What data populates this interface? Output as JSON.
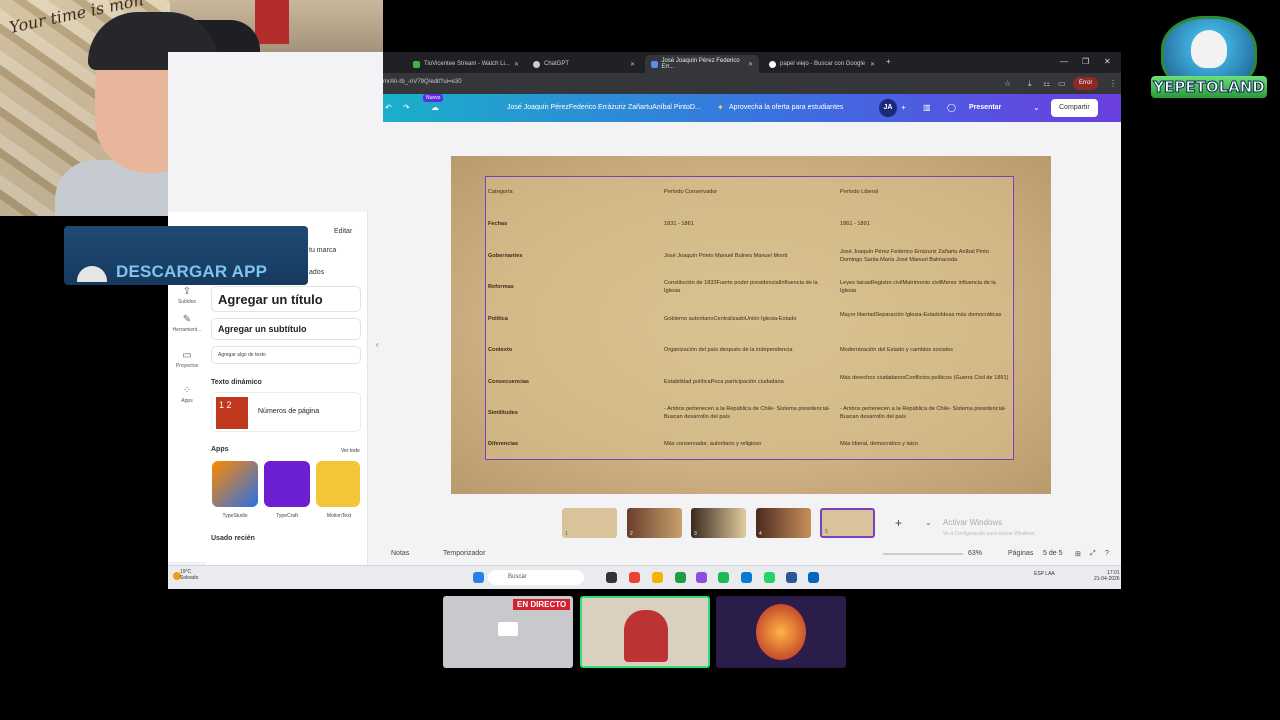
{
  "webcam": {
    "wall_text": "Your time is mon"
  },
  "download_banner": {
    "label": "DESCARGAR APP"
  },
  "logo": {
    "name": "YEPETOLAND"
  },
  "browser": {
    "tabs": [
      {
        "label": "TioVicentee Stream - Watch Li..."
      },
      {
        "label": "ChatGPT"
      },
      {
        "label": "José Joaquín Pérez Federico Err...",
        "active": true
      },
      {
        "label": "papel viejo - Buscar con Google"
      }
    ],
    "url": "mrAh-rb_-nV79Q/edit?ui=e30",
    "error_label": "Error"
  },
  "canva": {
    "new_badge": "Nuevo",
    "doc_title": "José Joaquín PérezFederico Errázuriz ZañartuAníbal PintoD...",
    "promo": "Aprovecha la oferta para estudiantes",
    "avatar": "JA",
    "present": "Presentar",
    "share": "Compartir"
  },
  "rail": [
    "Subidos",
    "Herramient...",
    "Proyectos",
    "Apps"
  ],
  "panel": {
    "edit": "Editar",
    "brand": "tu marca",
    "brand_sub": "ados",
    "title_card": "Agregar un título",
    "subtitle_card": "Agregar un subtítulo",
    "text_card": "Agregar algo de texto",
    "dynamic_text": "Texto dinámico",
    "page_numbers": "Números de página",
    "apps_heading": "Apps",
    "see_all": "Ver todo",
    "apps": [
      "TypeStudio",
      "TypeCraft",
      "MotionText"
    ],
    "recent": "Usado recién"
  },
  "slide": {
    "headers": [
      "Categoría",
      "Período Conservador",
      "Período Liberal"
    ],
    "rows": [
      [
        "Fechas",
        "1831 - 1861",
        "1861 - 1891"
      ],
      [
        "Gobernantes",
        "José Joaquín Prieto Manuel Bulnes Manuel Montt",
        "José Joaquín Pérez Federico Errázuriz Zañartu Aníbal Pinto Domingo Santa María José Manuel Balmaceda"
      ],
      [
        "Reformas",
        "Constitución de 1833Fuerte poder presidencialInfluencia de la Iglesia",
        "Leyes laicasRegistro civilMatrimonio civilMenor influencia de la Iglesia"
      ],
      [
        "Política",
        "Gobierno autoritarioCentralizadoUnión Iglesia-Estado",
        "Mayor libertadSeparación Iglesia-EstadoIdeas más democráticas"
      ],
      [
        "Contexto",
        "Organización del país después de la independencia",
        "Modernización del Estado y cambios sociales"
      ],
      [
        "Consecuencias",
        "Estabilidad políticaPoca participación ciudadana",
        "Más derechos ciudadanosConflictos políticos (Guerra Civil de 1891)"
      ],
      [
        "Similitudes",
        "- Ambos pertenecen a la República de Chile- Sistema presidencial- Buscan desarrollo del país",
        "- Ambos pertenecen a la República de Chile- Sistema presidencial- Buscan desarrollo del país"
      ],
      [
        "Diferencias",
        "Más conservador, autoritario y religioso",
        "Más liberal, democrático y laico"
      ]
    ]
  },
  "thumbs": [
    "1",
    "2",
    "3",
    "4",
    "5"
  ],
  "activate": {
    "title": "Activar Windows",
    "sub": "Ve a Configuración para activar Windows."
  },
  "bottombar": {
    "notes": "Notas",
    "timer": "Temporizador",
    "zoom": "63%",
    "pages": "Páginas",
    "page_count": "5 de 5"
  },
  "taskbar": {
    "temp": "19°C",
    "weather": "Soleado",
    "search": "Buscar",
    "lang": "ESP LAA",
    "time": "17:01",
    "date": "21-04-2026"
  },
  "overlay": {
    "live": "EN DIRECTO"
  },
  "colors": {
    "canva_gradient_start": "#1ab0c9",
    "canva_gradient_end": "#6a3ee0",
    "selection": "#7b3fbf",
    "live_red": "#d3212e"
  }
}
